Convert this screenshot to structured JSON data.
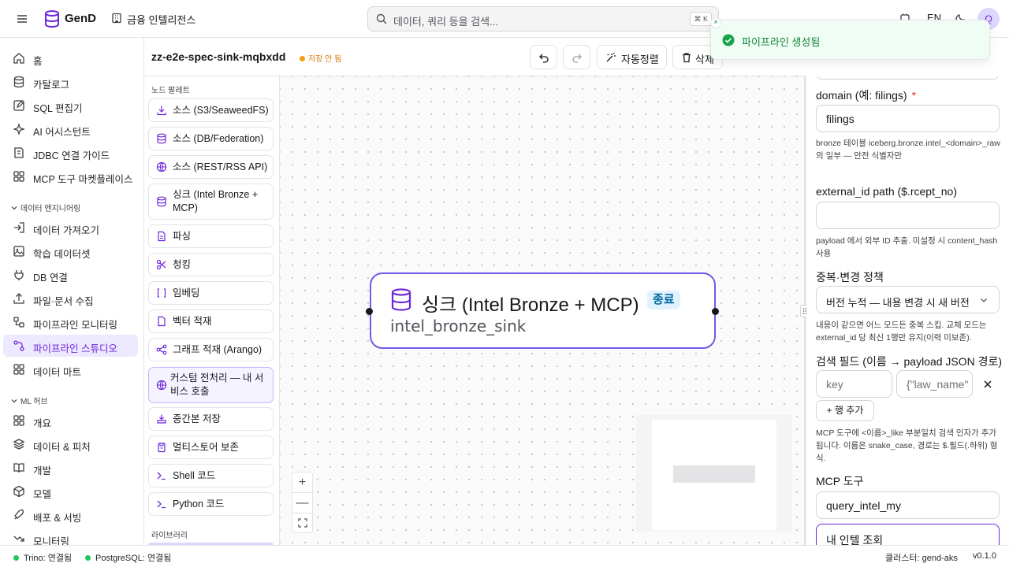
{
  "topbar": {
    "brand": "GenD",
    "workspace": "금융 인텔리전스",
    "search_placeholder": "데이터, 쿼리 등을 검색...",
    "shortcut": "⌘ K",
    "lang": "EN",
    "avatar": "Q"
  },
  "sidebar": {
    "items_top": [
      {
        "label": "홈",
        "icon": "home-icon"
      },
      {
        "label": "카탈로그",
        "icon": "database-icon"
      },
      {
        "label": "SQL 편집기",
        "icon": "edit-icon"
      },
      {
        "label": "AI 어시스턴트",
        "icon": "sparkles-icon"
      },
      {
        "label": "JDBC 연결 가이드",
        "icon": "book-icon"
      },
      {
        "label": "MCP 도구 마켓플레이스",
        "icon": "grid-icon"
      }
    ],
    "section_de": "데이터 엔지니어링",
    "items_de": [
      {
        "label": "데이터 가져오기",
        "icon": "import-icon"
      },
      {
        "label": "학습 데이터셋",
        "icon": "dataset-icon"
      },
      {
        "label": "DB 연결",
        "icon": "plug-icon"
      },
      {
        "label": "파일·문서 수집",
        "icon": "upload-icon"
      },
      {
        "label": "파이프라인 모니터링",
        "icon": "workflow-icon"
      },
      {
        "label": "파이프라인 스튜디오",
        "icon": "workflow-studio-icon"
      },
      {
        "label": "데이터 마트",
        "icon": "grid-icon"
      }
    ],
    "section_ml": "ML 허브",
    "items_ml": [
      {
        "label": "개요",
        "icon": "grid-icon"
      },
      {
        "label": "데이터 & 피처",
        "icon": "layers-icon"
      },
      {
        "label": "개발",
        "icon": "book-open-icon"
      },
      {
        "label": "모델",
        "icon": "box-icon"
      },
      {
        "label": "배포 & 서빙",
        "icon": "rocket-icon"
      },
      {
        "label": "모니터링",
        "icon": "trend-icon"
      }
    ]
  },
  "editor": {
    "pipeline_name": "zz-e2e-spec-sink-mqbxdd",
    "unsaved": "저장 안 됨",
    "auto_layout": "자동정렬",
    "delete": "삭제"
  },
  "palette": {
    "title": "노드 팔레트",
    "items": [
      {
        "label": "소스 (S3/SeaweedFS)",
        "icon": "download-icon"
      },
      {
        "label": "소스 (DB/Federation)",
        "icon": "database-icon"
      },
      {
        "label": "소스 (REST/RSS API)",
        "icon": "globe-icon"
      },
      {
        "label": "싱크 (Intel Bronze + MCP)",
        "icon": "database-icon"
      },
      {
        "label": "파싱",
        "icon": "file-icon"
      },
      {
        "label": "청킹",
        "icon": "scissors-icon"
      },
      {
        "label": "임베딩",
        "icon": "brackets-icon"
      },
      {
        "label": "벡터 적재",
        "icon": "file-icon"
      },
      {
        "label": "그래프 적재 (Arango)",
        "icon": "share-icon"
      },
      {
        "label": "커스텀 전처리 — 내 서비스 호출",
        "icon": "globe-icon"
      },
      {
        "label": "중간본 저장",
        "icon": "save-icon"
      },
      {
        "label": "멀티스토어 보존",
        "icon": "archive-icon"
      },
      {
        "label": "Shell 코드",
        "icon": "terminal-icon"
      },
      {
        "label": "Python 코드",
        "icon": "terminal-icon"
      }
    ],
    "library": "라이브러리"
  },
  "canvas": {
    "node_title": "싱크 (Intel Bronze + MCP)",
    "node_badge": "종료",
    "node_id": "intel_bronze_sink"
  },
  "config": {
    "domain_label": "domain (예: filings)",
    "domain_value": "filings",
    "domain_hint": "bronze 테이블 iceberg.bronze.intel_<domain>_raw 의 일부 — 안전 식별자만",
    "extid_label": "external_id path ($.rcept_no)",
    "extid_value": "",
    "extid_hint": "payload 에서 외부 ID 추출. 미설정 시 content_hash 사용",
    "dedup_label": "중복·변경 정책",
    "dedup_value": "버전 누적 — 내용 변경 시 새 버전",
    "dedup_hint": "내용이 같으면 어느 모드든 중복 스킵. 교체 모드는 external_id 당 최신 1행만 유지(이력 미보존).",
    "search_label": "검색 필드 (이름 → payload JSON 경로)",
    "key_placeholder": "key",
    "path_placeholder": "{\"law_name\"",
    "add_row": "+ 행 추가",
    "search_hint": "MCP 도구에 <이름>_like 부분일치 검색 인자가 추가됩니다. 이름은 snake_case, 경로는 $.필드(.하위) 형식.",
    "mcp_label": "MCP 도구",
    "mcp_value": "query_intel_my",
    "mcp_desc_value": "내 인텔 조회"
  },
  "status": {
    "trino": "Trino: 연결됨",
    "postgres": "PostgreSQL: 연결됨",
    "cluster": "클러스터: gend-aks",
    "version": "v0.1.0"
  },
  "toast": {
    "message": "파이프라인 생성됨"
  },
  "colors": {
    "accent": "#6d28d9",
    "success": "#22c55e",
    "warning": "#f59e0b"
  }
}
